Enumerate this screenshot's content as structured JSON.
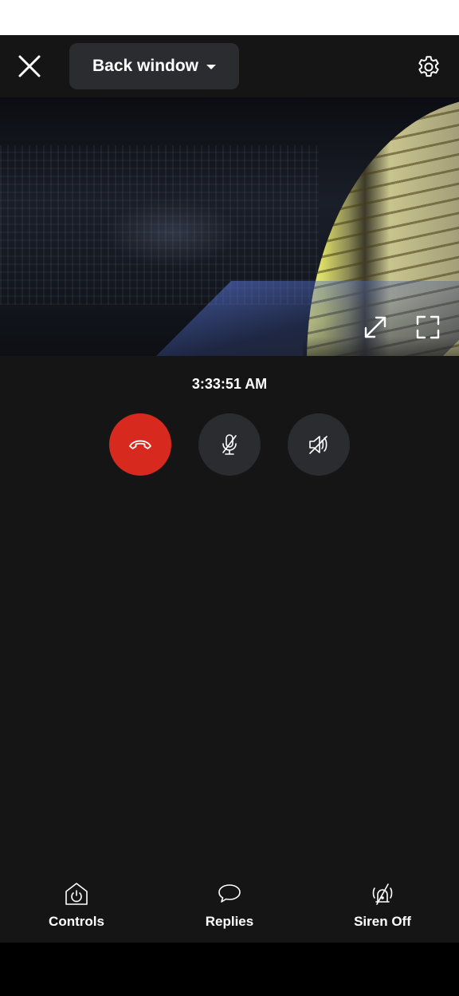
{
  "header": {
    "camera_name": "Back window"
  },
  "live": {
    "timestamp": "3:33:51 AM"
  },
  "bottom_nav": [
    {
      "label": "Controls"
    },
    {
      "label": "Replies"
    },
    {
      "label": "Siren Off"
    }
  ],
  "colors": {
    "background": "#151516",
    "hangup": "#d8291f",
    "button": "#2a2c30",
    "text": "#ffffff"
  },
  "icons": {
    "close": "close-icon",
    "dropdown": "caret-down-icon",
    "settings": "gear-icon",
    "expand": "expand-arrows-icon",
    "fullscreen": "fullscreen-icon",
    "hangup": "hang-up-phone-icon",
    "mute": "microphone-off-icon",
    "speaker": "speaker-off-icon",
    "controls": "home-power-icon",
    "replies": "speech-bubble-icon",
    "siren": "siren-off-icon"
  }
}
